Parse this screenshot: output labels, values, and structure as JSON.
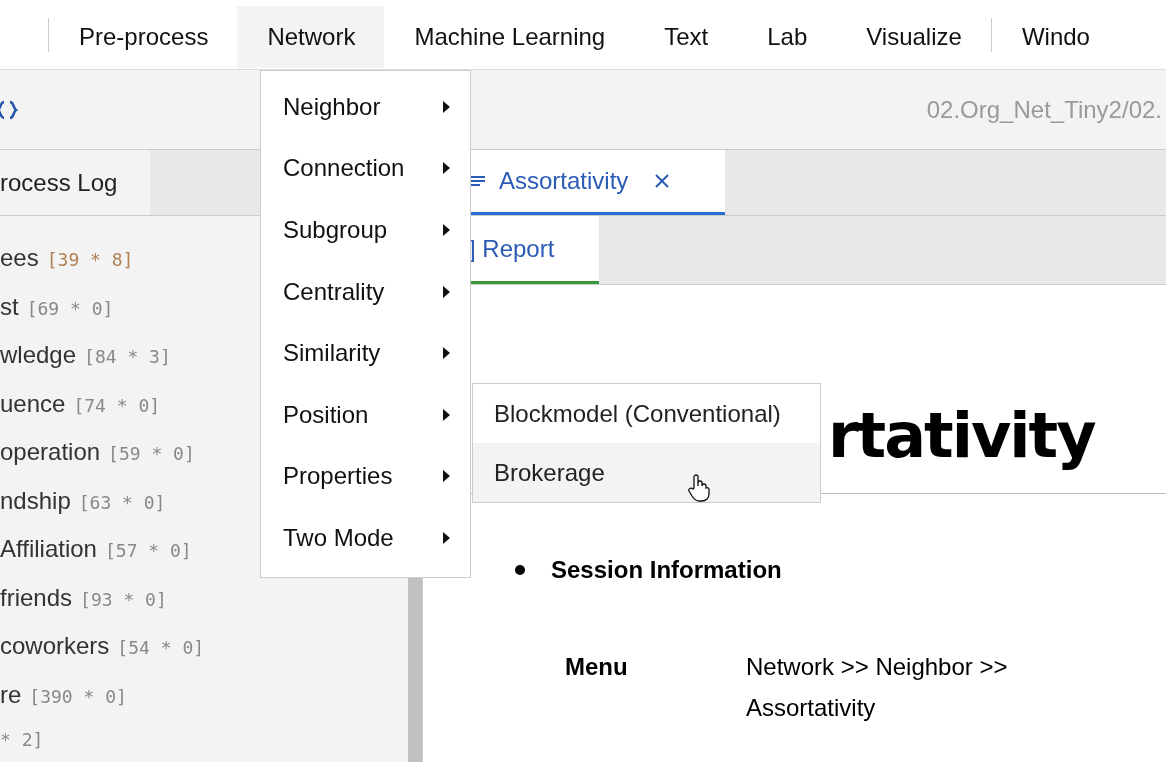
{
  "menu_bar": [
    {
      "label": "Pre-process",
      "selected": false
    },
    {
      "label": "Network",
      "selected": true
    },
    {
      "label": "Machine Learning",
      "selected": false
    },
    {
      "label": "Text",
      "selected": false
    },
    {
      "label": "Lab",
      "selected": false
    },
    {
      "label": "Visualize",
      "selected": false
    },
    {
      "label": "Windo",
      "selected": false
    }
  ],
  "network_menu": [
    {
      "label": "Neighbor"
    },
    {
      "label": "Connection"
    },
    {
      "label": "Subgroup"
    },
    {
      "label": "Centrality"
    },
    {
      "label": "Similarity"
    },
    {
      "label": "Position",
      "submenu": [
        {
          "label": "Blockmodel (Conventional)",
          "hovered": false
        },
        {
          "label": "Brokerage",
          "hovered": true
        }
      ]
    },
    {
      "label": "Properties"
    },
    {
      "label": "Two Mode"
    }
  ],
  "toolbar": {
    "path": "02.Org_Net_Tiny2/02."
  },
  "left_panel": {
    "tab": "rocess Log",
    "items": [
      {
        "name": "ees",
        "size": "[39 * 8]",
        "selected": true
      },
      {
        "name": "st",
        "size": "[69 * 0]",
        "selected": false
      },
      {
        "name": "wledge",
        "size": "[84 * 3]",
        "selected": false
      },
      {
        "name": "uence",
        "size": "[74 * 0]",
        "selected": false
      },
      {
        "name": "operation",
        "size": "[59 * 0]",
        "selected": false
      },
      {
        "name": "ndship",
        "size": "[63 * 0]",
        "selected": false
      },
      {
        "name": "Affiliation",
        "size": "[57 * 0]",
        "selected": false
      },
      {
        "name": "friends",
        "size": "[93 * 0]",
        "selected": false
      },
      {
        "name": "coworkers",
        "size": "[54 * 0]",
        "selected": false
      },
      {
        "name": "re",
        "size": "[390 * 0]",
        "selected": false
      },
      {
        "size": "* 2]",
        "selected": false
      }
    ]
  },
  "document_tabs": [
    {
      "label": "Assortativity",
      "selected": true
    }
  ],
  "sub_tabs": [
    {
      "label": "] Report",
      "selected": true
    }
  ],
  "report": {
    "heading": "rtativity",
    "section": "Session Information",
    "rows": [
      {
        "label": "Menu",
        "value": "Network >> Neighbor >> Assortativity"
      }
    ]
  }
}
